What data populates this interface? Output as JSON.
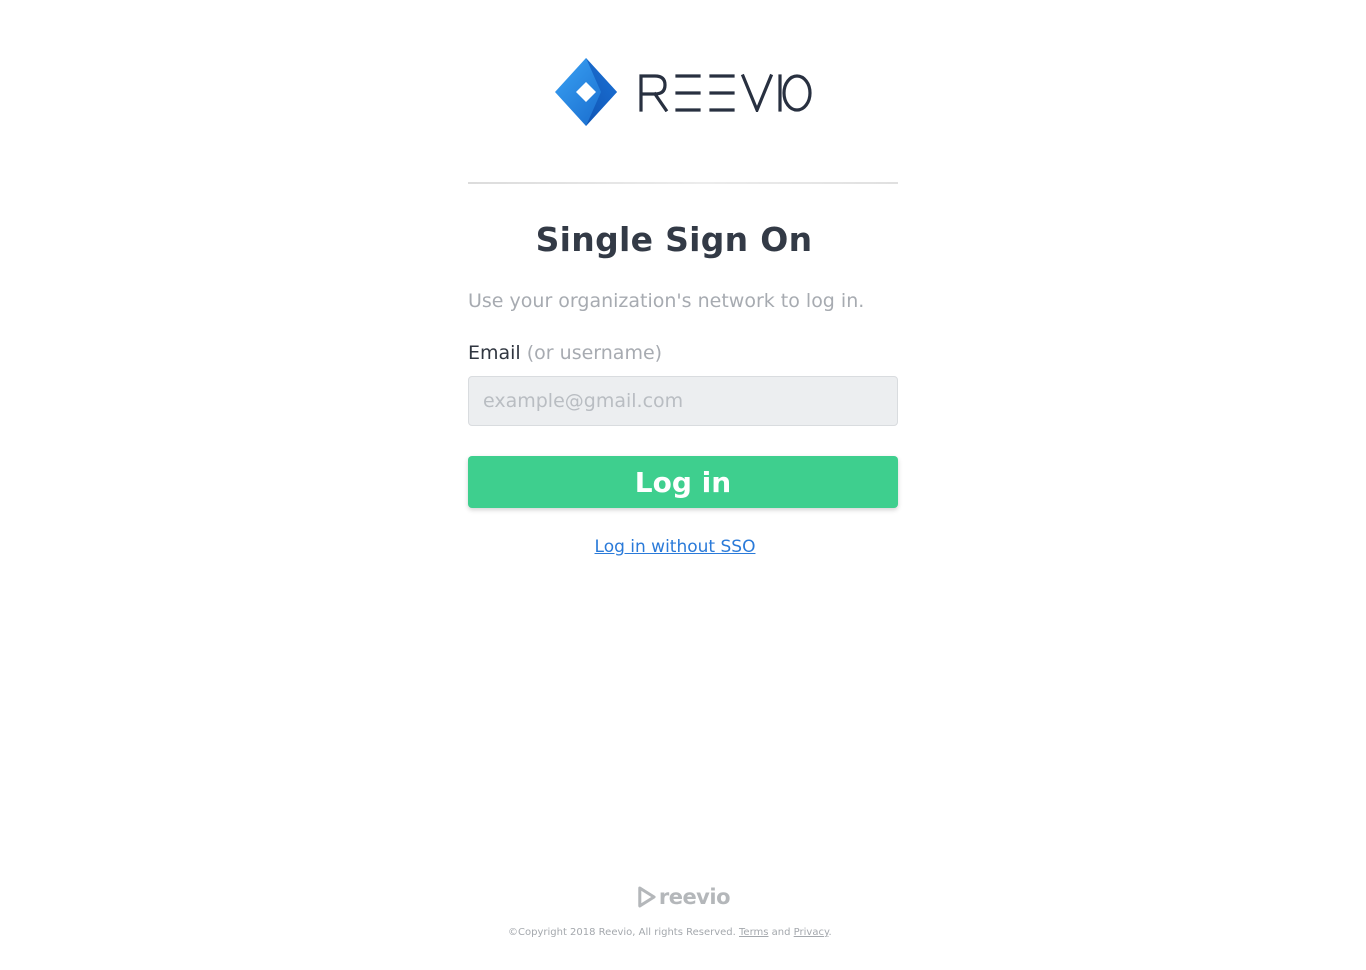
{
  "brand": {
    "name": "REEVIO",
    "footer_name": "reevio",
    "colors": {
      "primary_blue": "#1f7fe0",
      "accent_green": "#3ecf8e",
      "link_blue": "#2a7ad9",
      "heading": "#333a46"
    },
    "logo_icon": "diamond-logo-icon",
    "footer_icon": "play-logo-icon"
  },
  "form": {
    "title": "Single Sign On",
    "subtitle": "Use your organization's network to log in.",
    "email_label": "Email",
    "email_hint": "(or username)",
    "email_value": "",
    "email_placeholder": "example@gmail.com",
    "login_button": "Log in",
    "alt_link": "Log in without SSO"
  },
  "footer": {
    "copyright": "©Copyright 2018 Reevio, All rights Reserved.",
    "terms": "Terms",
    "and": "and",
    "privacy": "Privacy",
    "period": "."
  }
}
